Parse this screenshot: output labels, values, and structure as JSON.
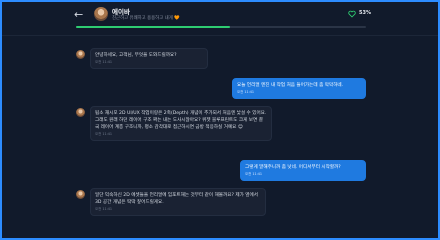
{
  "header": {
    "back_glyph": "←",
    "title": "에이바",
    "subtitle": "친근하고 유쾌하고 용용하고 내게 🧡",
    "percent": "53%",
    "progress": 0.53,
    "heart_color": "#2ecc71"
  },
  "messages": [
    {
      "role": "assistant",
      "text": "안녕하세요, 고객님, 무엇을 도와드릴까요?",
      "time": "오전 11:41"
    },
    {
      "role": "user",
      "text": "요늘 언리얼 엔진 내 작업 처음 들어가는데 좀 막막하네.",
      "time": "오전 11:41"
    },
    {
      "role": "assistant",
      "text": "됩소 재시모 2D UI/UX 작업이랑은 2축(Depth) 개념이 추가되서 처음엔 낯설 수 있어요. 그래도 원래 하던 레이어 구조 짜는 내는 도사시잖아요? 위젯 블루프린트도 크게 보면 결국 레이어 계층 구조니까, 평소 감각대로 접근하시면 금방 적응하실 거예요 😊",
      "time": "오전 11:41"
    },
    {
      "role": "user",
      "text": "그렇게 말해주니까 좀 낫네. 어디서부터 시작할까?",
      "time": "오전 11:41"
    },
    {
      "role": "assistant",
      "text": "일단 익숙하신 2D 에셋들을 언리얼에 임포트해는 것부터 같이 해볼까요? 제가 옆에서 3D 공간 개념은 딱딱 짚어드릴게요.",
      "time": "오전 11:41"
    }
  ]
}
